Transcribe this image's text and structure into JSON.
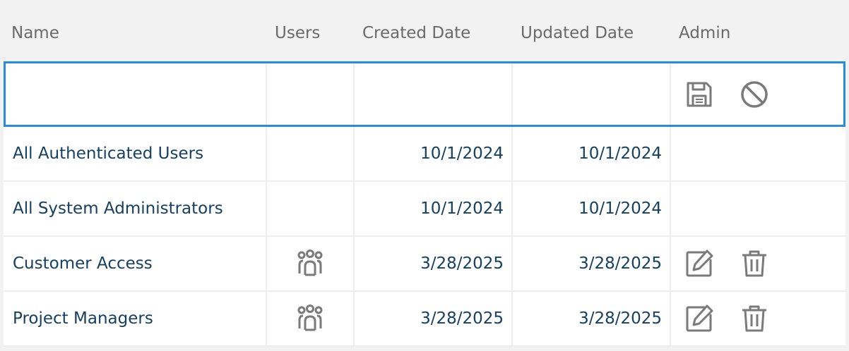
{
  "columns": {
    "name": "Name",
    "users": "Users",
    "created": "Created Date",
    "updated": "Updated Date",
    "admin": "Admin"
  },
  "edit_row": {
    "actions": [
      "save-icon",
      "cancel-icon"
    ]
  },
  "rows": [
    {
      "name": "All Authenticated Users",
      "has_users_icon": false,
      "created": "10/1/2024",
      "updated": "10/1/2024",
      "actions": []
    },
    {
      "name": "All System Administrators",
      "has_users_icon": false,
      "created": "10/1/2024",
      "updated": "10/1/2024",
      "actions": []
    },
    {
      "name": "Customer Access",
      "has_users_icon": true,
      "created": "3/28/2025",
      "updated": "3/28/2025",
      "actions": [
        "edit-icon",
        "delete-icon"
      ]
    },
    {
      "name": "Project Managers",
      "has_users_icon": true,
      "created": "3/28/2025",
      "updated": "3/28/2025",
      "actions": [
        "edit-icon",
        "delete-icon"
      ]
    }
  ],
  "colors": {
    "link_text": "#163f60",
    "icon": "#7a7a7a",
    "edit_border": "#2a8bdc"
  }
}
